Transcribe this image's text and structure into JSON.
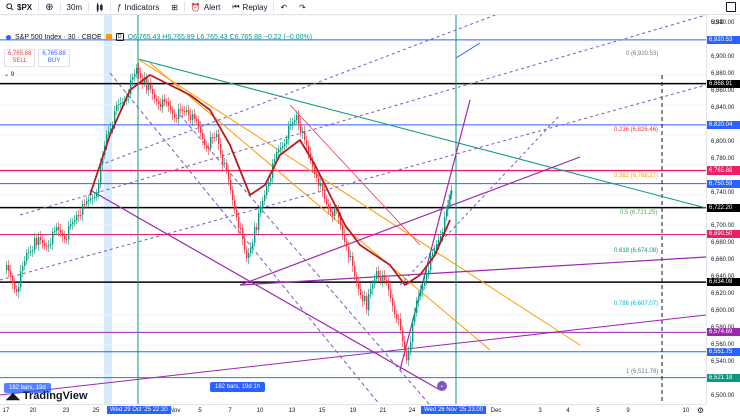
{
  "toolbar": {
    "symbol": "$PX",
    "interval": "30m",
    "indicators_label": "Indicators",
    "alert_label": "Alert",
    "replay_label": "Replay"
  },
  "legend": {
    "title": "S&P 500 Index · 30 · CBOE",
    "ohlc": "O6,765.43 H6,765.89 L6,765.43 C6,765.88 −0.22 (−0.00%)",
    "sell_price": "6,765.88",
    "sell_label": "SELL",
    "buy_price": "6,765.88",
    "buy_label": "BUY",
    "indicator_count": "9"
  },
  "price_axis": {
    "currency": "USD",
    "ticks": [
      "6,940.00",
      "6,900.00",
      "6,880.00",
      "6,860.00",
      "6,840.00",
      "6,800.00",
      "6,780.00",
      "6,740.00",
      "6,700.00",
      "6,680.00",
      "6,660.00",
      "6,640.00",
      "6,620.00",
      "6,600.00",
      "6,580.00",
      "6,560.00",
      "6,540.00",
      "6,500.00"
    ],
    "badges": [
      {
        "label": "6,920.53",
        "color": "#2962ff"
      },
      {
        "label": "6,868.91",
        "color": "#000000"
      },
      {
        "label": "6,820.04",
        "color": "#2962ff"
      },
      {
        "label": "6,766.29",
        "color": "#e91e63"
      },
      {
        "label": "6,765.88",
        "color": "#e91e63"
      },
      {
        "label": "6,750.59",
        "color": "#2962ff"
      },
      {
        "label": "6,722.20",
        "color": "#000000"
      },
      {
        "label": "6,690.50",
        "color": "#e91e63"
      },
      {
        "label": "6,634.08",
        "color": "#000000"
      },
      {
        "label": "6,574.69",
        "color": "#9c27b0"
      },
      {
        "label": "6,551.75",
        "color": "#2962ff"
      },
      {
        "label": "6,521.18",
        "color": "#089981"
      }
    ]
  },
  "fib_levels": [
    {
      "label": "0 (6,920.53)",
      "color": "#787b86"
    },
    {
      "label": "0.236 (6,826.46)",
      "color": "#f23645"
    },
    {
      "label": "0.382 (6,768.27)",
      "color": "#ff9800"
    },
    {
      "label": "0.5 (6,721.25)",
      "color": "#4caf50"
    },
    {
      "label": "0.618 (6,674.08)",
      "color": "#089981"
    },
    {
      "label": "0.786 (6,607.07)",
      "color": "#00bcd4"
    },
    {
      "label": "1 (6,521.78)",
      "color": "#787b86"
    }
  ],
  "time_axis": {
    "ticks": [
      "17",
      "20",
      "23",
      "25",
      "30",
      "Nov",
      "5",
      "7",
      "10",
      "13",
      "15",
      "19",
      "21",
      "24",
      "Dec",
      "3",
      "4",
      "5",
      "9",
      "10"
    ],
    "start_badge": "Wed 29 Oct '25  22:30",
    "end_badge": "Wed 26 Nov '25  23:00"
  },
  "range_label": "182 bars, 19d 1h",
  "left_range_label": "182 bars, 19d",
  "logo": "TradingView",
  "chart_data": {
    "type": "candlestick",
    "y_range": [
      6490,
      6950
    ],
    "title": "S&P 500 Index · 30 · CBOE"
  },
  "colors": {
    "up": "#089981",
    "down": "#f23645",
    "accent": "#2962ff"
  }
}
